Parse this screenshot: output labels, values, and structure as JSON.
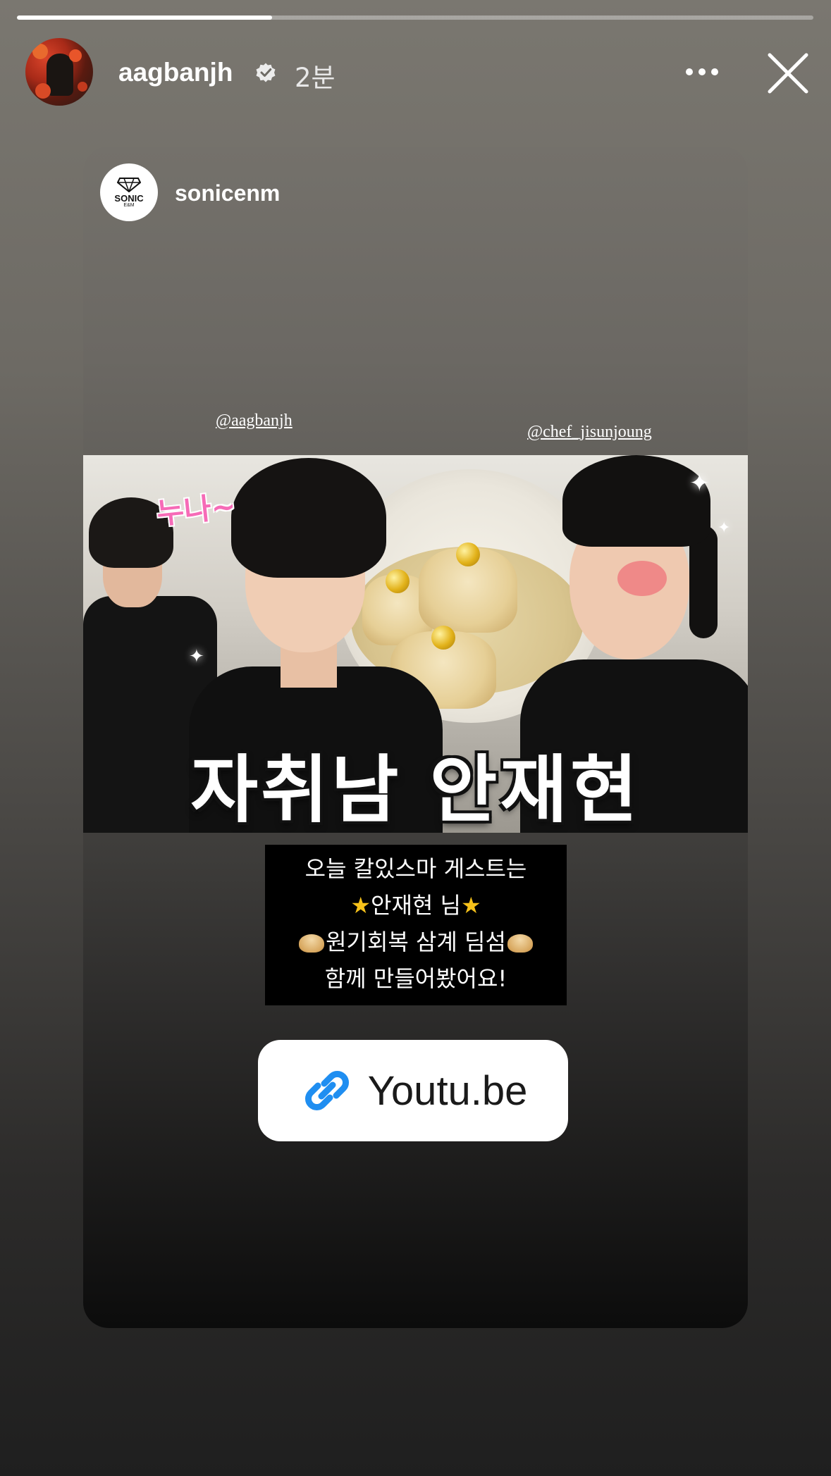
{
  "story": {
    "progress": 0.32,
    "username": "aagbanjh",
    "time_ago": "2분",
    "verified": true
  },
  "header": {
    "more_icon": "more-horizontal-icon",
    "close_icon": "close-icon"
  },
  "shared_post": {
    "username": "sonicenm",
    "avatar_logo_text": "SONIC",
    "avatar_logo_sub": "E&M",
    "mentions": [
      "@aagbanjh",
      "@chef_jisunjoung"
    ],
    "thumbnail": {
      "sticker_text": "누나~",
      "title": "자취남 안재현"
    },
    "caption_lines": [
      "오늘 칼있스마 게스트는",
      "안재현 님",
      "원기회복 삼계 딤섬",
      "함께 만들어봤어요!"
    ],
    "caption_emoji": {
      "line2": "star-icon",
      "line3": "dumpling-icon"
    },
    "link_sticker": {
      "label": "Youtu.be",
      "icon": "link-icon",
      "accent": "#1f8ef1"
    }
  }
}
